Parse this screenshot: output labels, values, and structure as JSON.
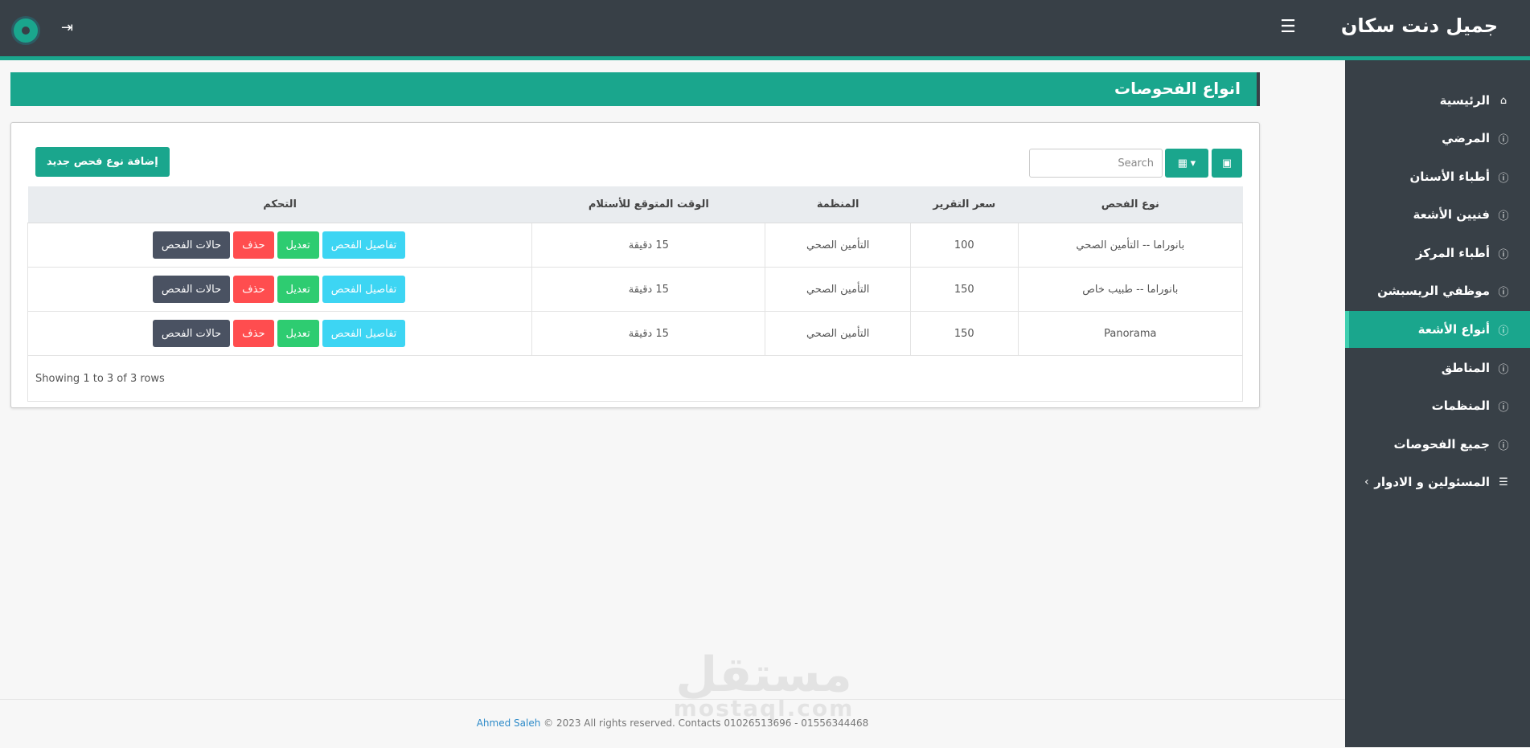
{
  "app": {
    "brand": "جميل دنت سكان"
  },
  "header": {
    "menu_icon": "☰",
    "logout_icon": "⇥"
  },
  "sidebar": {
    "items": [
      {
        "label": "الرئيسية",
        "icon": "⌂"
      },
      {
        "label": "المرضي",
        "icon": "ⓘ"
      },
      {
        "label": "أطباء الأسنان",
        "icon": "ⓘ"
      },
      {
        "label": "فنيين الأشعة",
        "icon": "ⓘ"
      },
      {
        "label": "أطباء المركز",
        "icon": "ⓘ"
      },
      {
        "label": "موظفي الريسبشن",
        "icon": "ⓘ"
      },
      {
        "label": "أنواع الأشعة",
        "icon": "ⓘ",
        "active": true
      },
      {
        "label": "المناطق",
        "icon": "ⓘ"
      },
      {
        "label": "المنظمات",
        "icon": "ⓘ"
      },
      {
        "label": "جميع الفحوصات",
        "icon": "ⓘ"
      },
      {
        "label": "المسئولين و الادوار",
        "icon": "☰",
        "chevron": "‹"
      }
    ]
  },
  "page": {
    "title": "انواع الفحوصات"
  },
  "toolbar": {
    "add_label": "إضافة نوع فحص جديد",
    "search_placeholder": "Search",
    "columns_icon": "▦ ▾",
    "toggle_icon": "▣"
  },
  "table": {
    "headers": [
      "نوع الفحص",
      "سعر التقرير",
      "المنظمة",
      "الوقت المتوقع للأستلام",
      "التحكم"
    ],
    "rows": [
      {
        "type": "بانوراما -- التأمين الصحي",
        "price": "100",
        "org": "التأمين الصحي",
        "time": "15 دقيقة"
      },
      {
        "type": "بانوراما -- طبيب خاص",
        "price": "150",
        "org": "التأمين الصحي",
        "time": "15 دقيقة"
      },
      {
        "type": "Panorama",
        "price": "150",
        "org": "التأمين الصحي",
        "time": "15 دقيقة"
      }
    ],
    "actions": {
      "details": "تفاصيل الفحص",
      "edit": "تعديل",
      "delete": "حذف",
      "states": "حالات الفحص"
    },
    "pagination_text": "Showing 1 to 3 of 3 rows"
  },
  "watermark": {
    "ar": "مستقل",
    "en": "mostaql.com"
  },
  "footer": {
    "author": "Ahmed Saleh",
    "text": " © 2023 All rights reserved. Contacts 01026513696 - 01556344468"
  },
  "colors": {
    "accent": "#1aa68d",
    "dark": "#384047"
  }
}
